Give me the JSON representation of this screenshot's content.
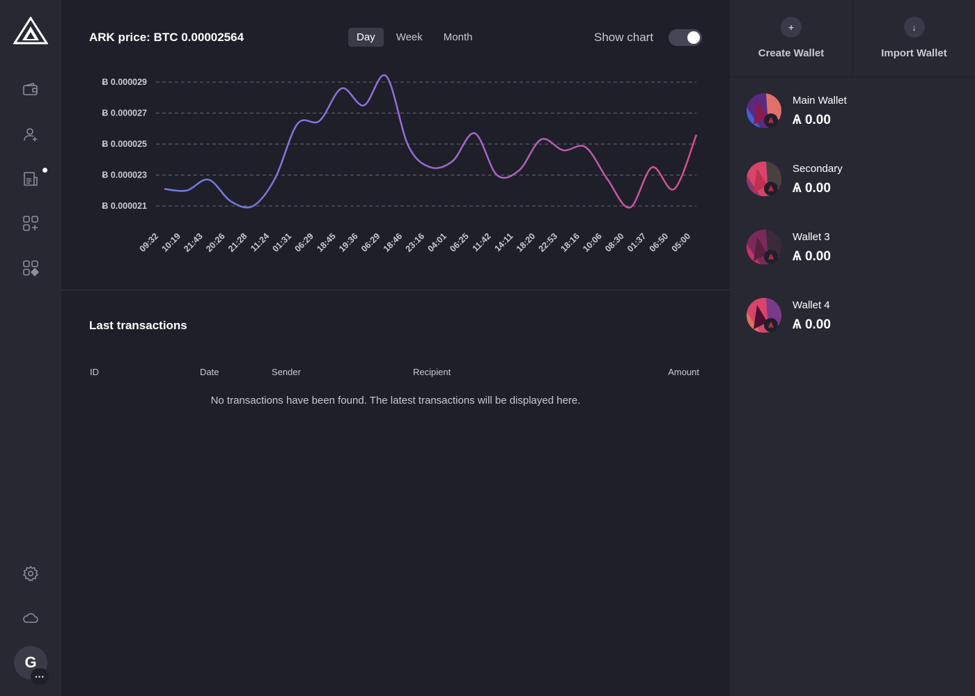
{
  "sidebar": {
    "logo": "ark-logo",
    "items": [
      {
        "name": "wallet-icon"
      },
      {
        "name": "add-contact-icon"
      },
      {
        "name": "document-icon",
        "has_notification": true
      },
      {
        "name": "plugin-add-icon"
      },
      {
        "name": "plugins-icon"
      },
      {
        "name": "settings-icon"
      },
      {
        "name": "cloud-icon"
      }
    ],
    "profile_initial": "G",
    "profile_more": "···"
  },
  "price": {
    "title": "ARK price: BTC 0.00002564",
    "periods": [
      "Day",
      "Week",
      "Month"
    ],
    "active_period": "Day",
    "show_chart_label": "Show chart",
    "show_chart_enabled": true
  },
  "chart_data": {
    "type": "line",
    "title": "",
    "xlabel": "",
    "ylabel": "",
    "grid": true,
    "yticks": [
      "Ƀ 0.000029",
      "Ƀ 0.000027",
      "Ƀ 0.000025",
      "Ƀ 0.000023",
      "Ƀ 0.000021"
    ],
    "ylim": [
      2.1e-05,
      2.9e-05
    ],
    "categories": [
      "09:32",
      "10:19",
      "21:43",
      "20:26",
      "21:28",
      "11:24",
      "01:31",
      "06:29",
      "18:45",
      "19:36",
      "06:29",
      "18:46",
      "23:16",
      "04:01",
      "06:25",
      "11:42",
      "14:11",
      "18:20",
      "22:53",
      "18:16",
      "10:06",
      "08:30",
      "01:37",
      "06:50",
      "05:00"
    ],
    "values": [
      2.21e-05,
      2.2e-05,
      2.27e-05,
      2.13e-05,
      2.1e-05,
      2.28e-05,
      2.63e-05,
      2.65e-05,
      2.86e-05,
      2.75e-05,
      2.94e-05,
      2.49e-05,
      2.35e-05,
      2.39e-05,
      2.57e-05,
      2.3e-05,
      2.33e-05,
      2.53e-05,
      2.46e-05,
      2.48e-05,
      2.27e-05,
      2.09e-05,
      2.35e-05,
      2.21e-05,
      2.56e-05
    ],
    "colors": [
      "#6b7ee0",
      "#9b6bd6",
      "#d6508a"
    ]
  },
  "transactions": {
    "title": "Last transactions",
    "columns": [
      "ID",
      "Date",
      "Sender",
      "Recipient",
      "Amount"
    ],
    "empty_message": "No transactions have been found. The latest transactions will be displayed here."
  },
  "wallet_actions": {
    "create_label": "Create Wallet",
    "create_icon": "+",
    "import_label": "Import Wallet",
    "import_icon": "↓"
  },
  "wallets": [
    {
      "name": "Main Wallet",
      "balance": "Ѧ 0.00",
      "colors": [
        "#5a2a80",
        "#e0706a",
        "#4060d8",
        "#8a1a4a"
      ]
    },
    {
      "name": "Secondary",
      "balance": "Ѧ 0.00",
      "colors": [
        "#d8446a",
        "#4a4040",
        "#8a3a6a",
        "#c03050"
      ]
    },
    {
      "name": "Wallet 3",
      "balance": "Ѧ 0.00",
      "colors": [
        "#7a2a5a",
        "#3a2a3a",
        "#c8306a",
        "#5a2040"
      ]
    },
    {
      "name": "Wallet 4",
      "balance": "Ѧ 0.00",
      "colors": [
        "#d8446a",
        "#7a3a8a",
        "#e07060",
        "#4a1030"
      ]
    }
  ]
}
